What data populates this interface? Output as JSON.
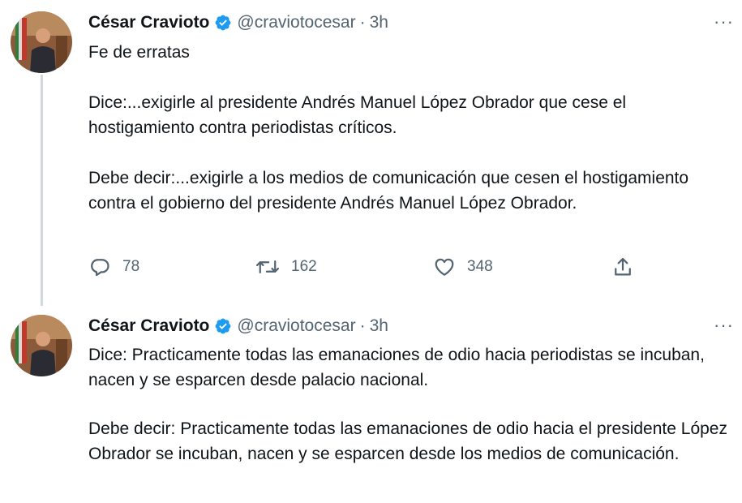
{
  "tweets": [
    {
      "author_name": "César Cravioto",
      "handle": "@craviotocesar",
      "separator": "·",
      "time": "3h",
      "more": "···",
      "paragraphs": [
        "Fe de erratas",
        "Dice:...exigirle al presidente Andrés Manuel López Obrador que cese el hostigamiento contra periodistas críticos.",
        "Debe decir:...exigirle a los medios de comunicación que cesen el hostigamiento contra el gobierno del presidente Andrés Manuel López Obrador."
      ],
      "actions": {
        "replies": "78",
        "retweets": "162",
        "likes": "348"
      }
    },
    {
      "author_name": "César Cravioto",
      "handle": "@craviotocesar",
      "separator": "·",
      "time": "3h",
      "more": "···",
      "paragraphs": [
        "Dice: Practicamente todas las emanaciones de odio hacia periodistas se incuban, nacen y se esparcen desde palacio nacional.",
        "Debe decir: Practicamente todas las emanaciones de odio hacia el presidente López Obrador se incuban, nacen y se esparcen desde los medios de comunicación."
      ]
    }
  ],
  "icons": {
    "verified": "verified-badge-icon",
    "reply": "reply-icon",
    "retweet": "retweet-icon",
    "like": "heart-icon",
    "share": "share-icon",
    "more": "more-icon"
  },
  "colors": {
    "text": "#0f1419",
    "secondary": "#536471",
    "verified": "#1d9bf0",
    "thread_line": "#cfd9de"
  }
}
